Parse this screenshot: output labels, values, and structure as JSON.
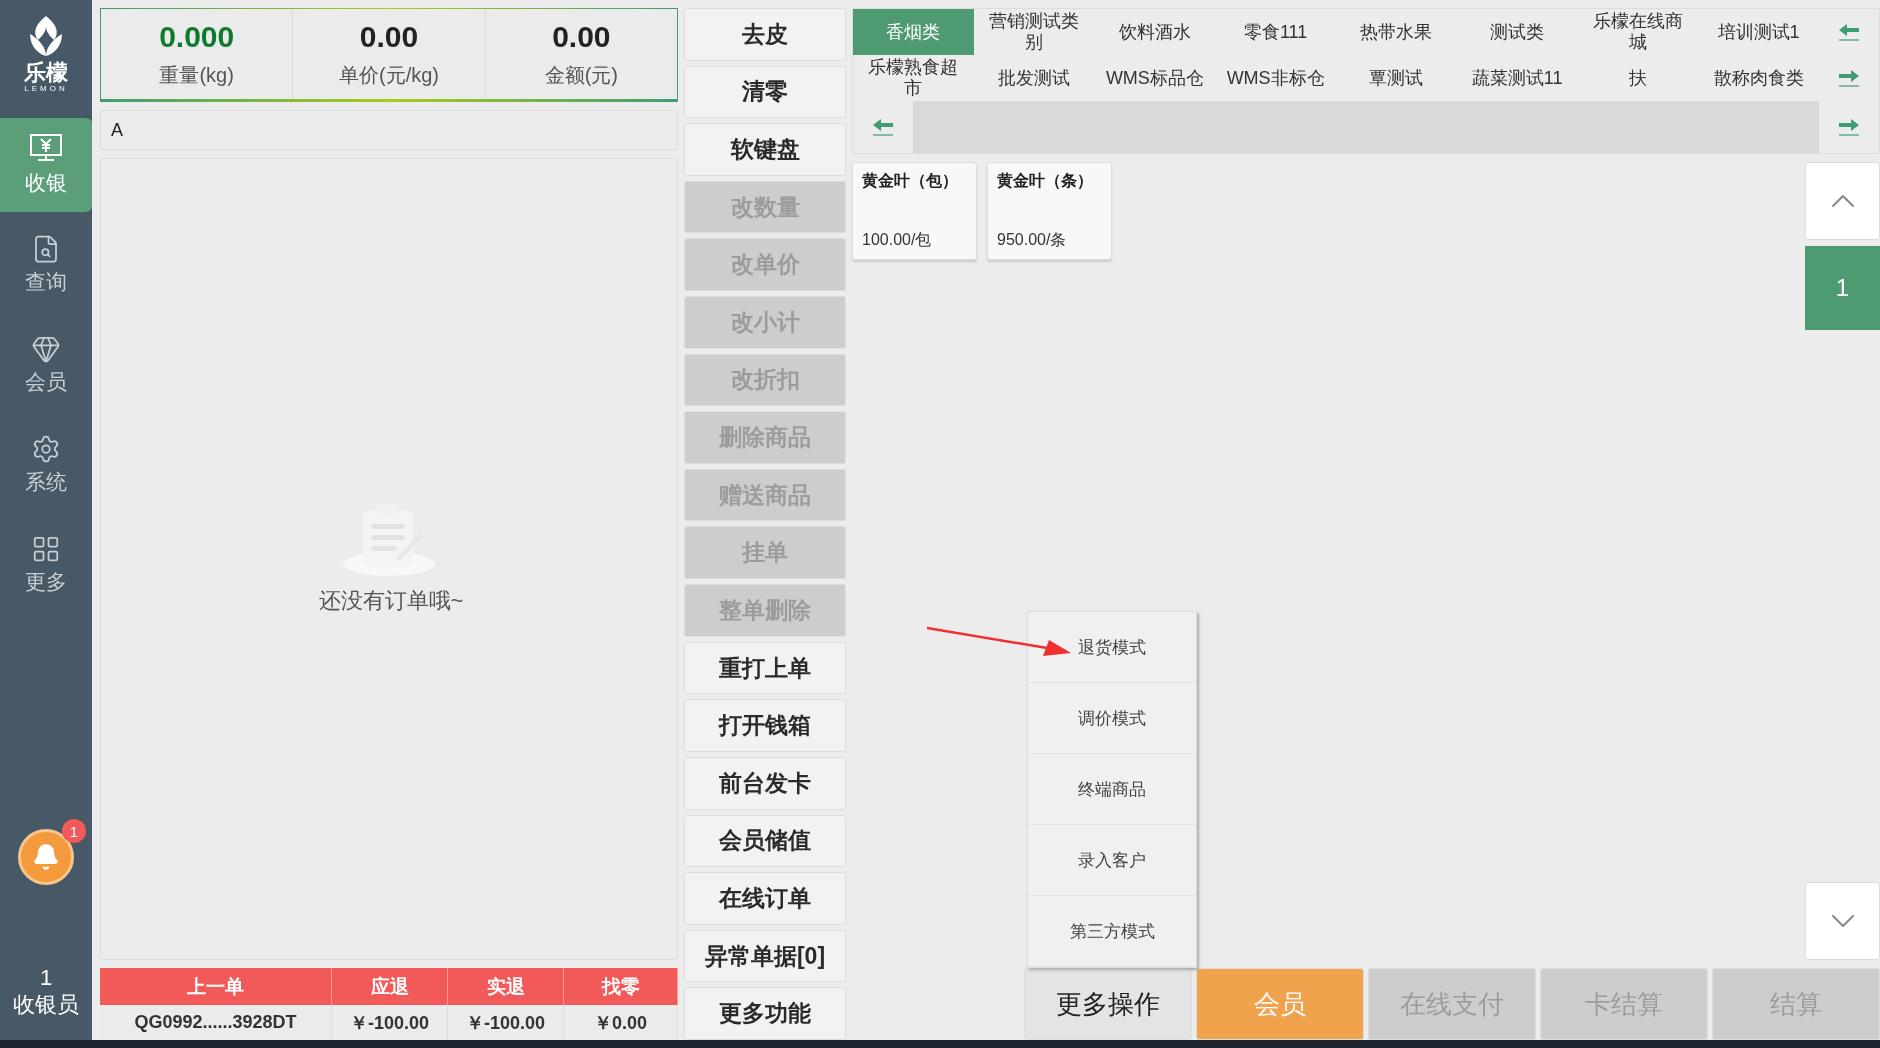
{
  "sidebar": {
    "logo_text": "乐檬",
    "logo_sub": "LEMON",
    "items": [
      {
        "label": "收银",
        "selected": true
      },
      {
        "label": "查询",
        "selected": false
      },
      {
        "label": "会员",
        "selected": false
      },
      {
        "label": "系统",
        "selected": false
      },
      {
        "label": "更多",
        "selected": false
      }
    ],
    "notification_count": "1",
    "cashier": {
      "id": "1",
      "role": "收银员"
    }
  },
  "scale": [
    {
      "value": "0.000",
      "label": "重量(kg)",
      "highlighted": true
    },
    {
      "value": "0.00",
      "label": "单价(元/kg)",
      "highlighted": false
    },
    {
      "value": "0.00",
      "label": "金额(元)",
      "highlighted": false
    }
  ],
  "search": {
    "value": "A"
  },
  "empty_state": {
    "message": "还没有订单哦~"
  },
  "last_order": {
    "columns": [
      "上一单",
      "应退",
      "实退",
      "找零"
    ],
    "values": [
      "QG0992......3928DT",
      "￥-100.00",
      "￥-100.00",
      "￥0.00"
    ]
  },
  "function_buttons": [
    {
      "label": "去皮",
      "disabled": false
    },
    {
      "label": "清零",
      "disabled": false
    },
    {
      "label": "软键盘",
      "disabled": false
    },
    {
      "label": "改数量",
      "disabled": true
    },
    {
      "label": "改单价",
      "disabled": true
    },
    {
      "label": "改小计",
      "disabled": true
    },
    {
      "label": "改折扣",
      "disabled": true
    },
    {
      "label": "删除商品",
      "disabled": true
    },
    {
      "label": "赠送商品",
      "disabled": true
    },
    {
      "label": "挂单",
      "disabled": true
    },
    {
      "label": "整单删除",
      "disabled": true
    },
    {
      "label": "重打上单",
      "disabled": false
    },
    {
      "label": "打开钱箱",
      "disabled": false
    },
    {
      "label": "前台发卡",
      "disabled": false
    },
    {
      "label": "会员储值",
      "disabled": false
    },
    {
      "label": "在线订单",
      "disabled": false
    },
    {
      "label": "异常单据[0]",
      "disabled": false
    },
    {
      "label": "更多功能",
      "disabled": false
    }
  ],
  "categories": [
    [
      {
        "label": "香烟类",
        "selected": true
      },
      {
        "label": "营销测试类别",
        "selected": false
      },
      {
        "label": "饮料酒水",
        "selected": false
      },
      {
        "label": "零食111",
        "selected": false
      },
      {
        "label": "热带水果",
        "selected": false
      },
      {
        "label": "测试类",
        "selected": false
      },
      {
        "label": "乐檬在线商城",
        "selected": false
      },
      {
        "label": "培训测试1",
        "selected": false
      }
    ],
    [
      {
        "label": "乐檬熟食超市",
        "selected": false
      },
      {
        "label": "批发测试",
        "selected": false
      },
      {
        "label": "WMS标品仓",
        "selected": false
      },
      {
        "label": "WMS非标仓",
        "selected": false
      },
      {
        "label": "覃测试",
        "selected": false
      },
      {
        "label": "蔬菜测试11",
        "selected": false
      },
      {
        "label": "扶",
        "selected": false
      },
      {
        "label": "散称肉食类",
        "selected": false
      }
    ]
  ],
  "products": [
    {
      "name": "黄金叶（包）",
      "price": "100.00/包"
    },
    {
      "name": "黄金叶（条）",
      "price": "950.00/条"
    }
  ],
  "pager": {
    "page": "1"
  },
  "more_menu": {
    "items": [
      "退货模式",
      "调价模式",
      "终端商品",
      "录入客户",
      "第三方模式"
    ]
  },
  "bottom_buttons": [
    {
      "label": "更多操作",
      "kind": "plain"
    },
    {
      "label": "会员",
      "kind": "accent"
    },
    {
      "label": "在线支付",
      "kind": "disabled"
    },
    {
      "label": "卡结算",
      "kind": "disabled"
    },
    {
      "label": "结算",
      "kind": "disabled"
    }
  ]
}
